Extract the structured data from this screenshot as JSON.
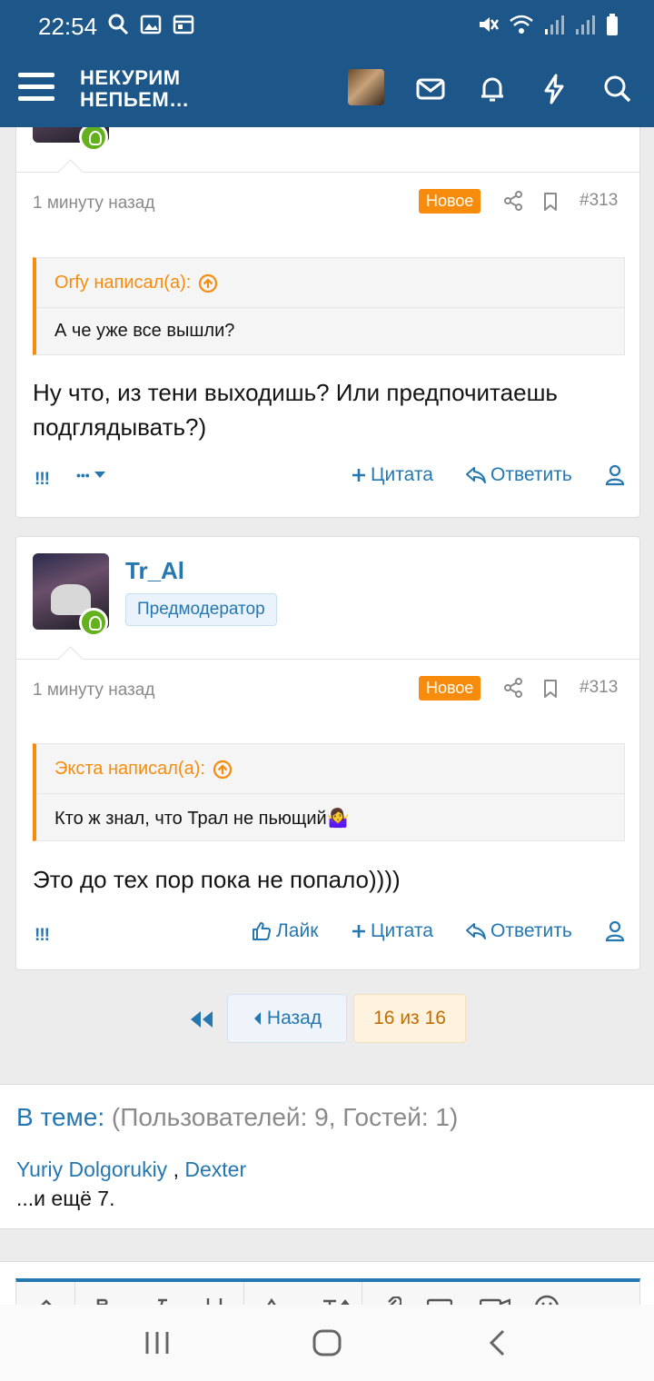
{
  "status_bar": {
    "time": "22:54"
  },
  "header": {
    "logo_line1": "НЕКУРИМ",
    "logo_line2": "НЕПЬЕМ…"
  },
  "posts": [
    {
      "time": "1 минуту назад",
      "badge": "Новое",
      "number": "#313",
      "quote_author": "Orfy написал(а):",
      "quote_text": "А че уже все вышли?",
      "text": "Ну что, из тени выходишь? Или предпочитаешь подглядывать?)",
      "actions": {
        "react": "!!!",
        "more": "•••",
        "quote": "Цитата",
        "reply": "Ответить"
      }
    },
    {
      "username": "Tr_Al",
      "user_title": "Предмодератор",
      "time": "1 минуту назад",
      "badge": "Новое",
      "number": "#313",
      "quote_author": "Экста написал(а):",
      "quote_text": "Кто ж знал, что Трал не пьющий🤷‍♀️",
      "text": "Это до тех пор пока не попало))))",
      "actions": {
        "react": "!!!",
        "like": "Лайк",
        "quote": "Цитата",
        "reply": "Ответить"
      }
    }
  ],
  "pager": {
    "back": "Назад",
    "current": "16 из 16"
  },
  "online": {
    "label": "В теме:",
    "counts": "(Пользователей: 9, Гостей: 1)",
    "users": [
      "Yuriy Dolgorukiy",
      "Dexter"
    ],
    "separator": " , ",
    "more": "...и ещё 7."
  },
  "icons": {
    "menu": "menu-icon",
    "mail": "mail-icon",
    "bell": "bell-icon",
    "bolt": "bolt-icon",
    "search": "search-icon",
    "share": "share-icon",
    "bookmark": "bookmark-icon",
    "user": "user-icon"
  },
  "colors": {
    "header": "#1d5688",
    "link": "#2577b1",
    "accent": "#f78c0c",
    "online": "#63b11c"
  }
}
